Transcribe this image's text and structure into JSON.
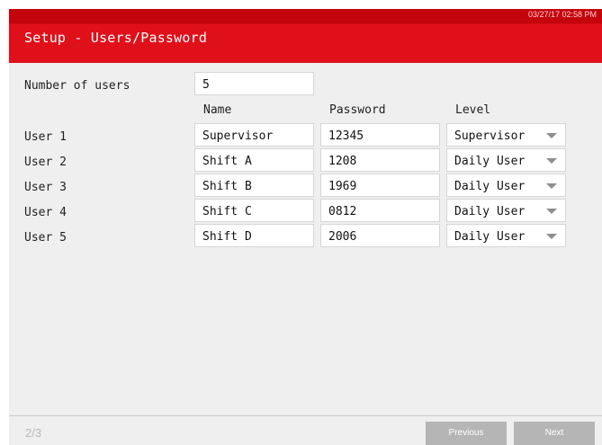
{
  "header": {
    "timestamp": "03/27/17 02:58 PM",
    "title": "Setup - Users/Password"
  },
  "number_of_users": {
    "label": "Number of users",
    "value": "5"
  },
  "columns": {
    "name": "Name",
    "password": "Password",
    "level": "Level"
  },
  "users": [
    {
      "label": "User 1",
      "name": "Supervisor",
      "password": "12345",
      "level": "Supervisor"
    },
    {
      "label": "User 2",
      "name": "Shift A",
      "password": "1208",
      "level": "Daily User"
    },
    {
      "label": "User 3",
      "name": "Shift B",
      "password": "1969",
      "level": "Daily User"
    },
    {
      "label": "User 4",
      "name": "Shift C",
      "password": "0812",
      "level": "Daily User"
    },
    {
      "label": "User 5",
      "name": "Shift D",
      "password": "2006",
      "level": "Daily User"
    }
  ],
  "footer": {
    "page": "2/3",
    "previous_label": "Previous",
    "next_label": "Next"
  },
  "colors": {
    "header_red": "#e0101a",
    "background": "#efefef",
    "button_gray": "#b5b5b5"
  },
  "icons": {
    "dropdown": "chevron-down-icon"
  }
}
